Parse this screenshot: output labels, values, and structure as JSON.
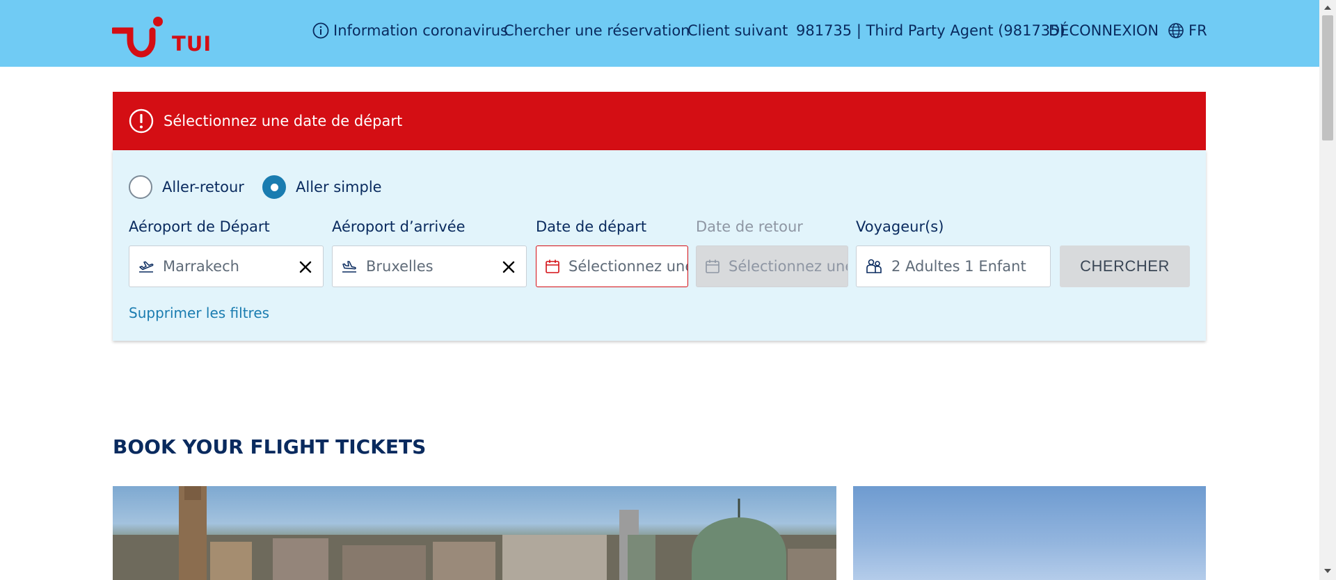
{
  "header": {
    "logo_text": "TUI",
    "nav": {
      "info_label": "Information coronavirus",
      "search_booking_label": "Chercher une réservation",
      "next_client_label": "Client suivant",
      "agent_label": "981735 | Third Party Agent (981735)",
      "logout_label": "DÉCONNEXION",
      "language_label": "FR"
    }
  },
  "error": {
    "message": "Sélectionnez une date de départ"
  },
  "search": {
    "trip_types": {
      "round_trip_label": "Aller-retour",
      "one_way_label": "Aller simple",
      "selected": "one_way"
    },
    "departure": {
      "label": "Aéroport de Départ",
      "value": "Marrakech"
    },
    "arrival": {
      "label": "Aéroport d’arrivée",
      "value": "Bruxelles"
    },
    "departure_date": {
      "label": "Date de départ",
      "placeholder": "Sélectionnez une date"
    },
    "return_date": {
      "label": "Date de retour",
      "placeholder": "Sélectionnez une date"
    },
    "travellers": {
      "label": "Voyageur(s)",
      "value": "2 Adultes 1 Enfant"
    },
    "submit_label": "CHERCHER",
    "clear_filters_label": "Supprimer les filtres"
  },
  "main": {
    "heading": "BOOK YOUR FLIGHT TICKETS"
  },
  "colors": {
    "header_bg": "#70cbf4",
    "brand_red": "#d40e14",
    "navy": "#092a5e",
    "panel_bg": "#e2f4fb",
    "accent_blue": "#1a7cb0"
  }
}
